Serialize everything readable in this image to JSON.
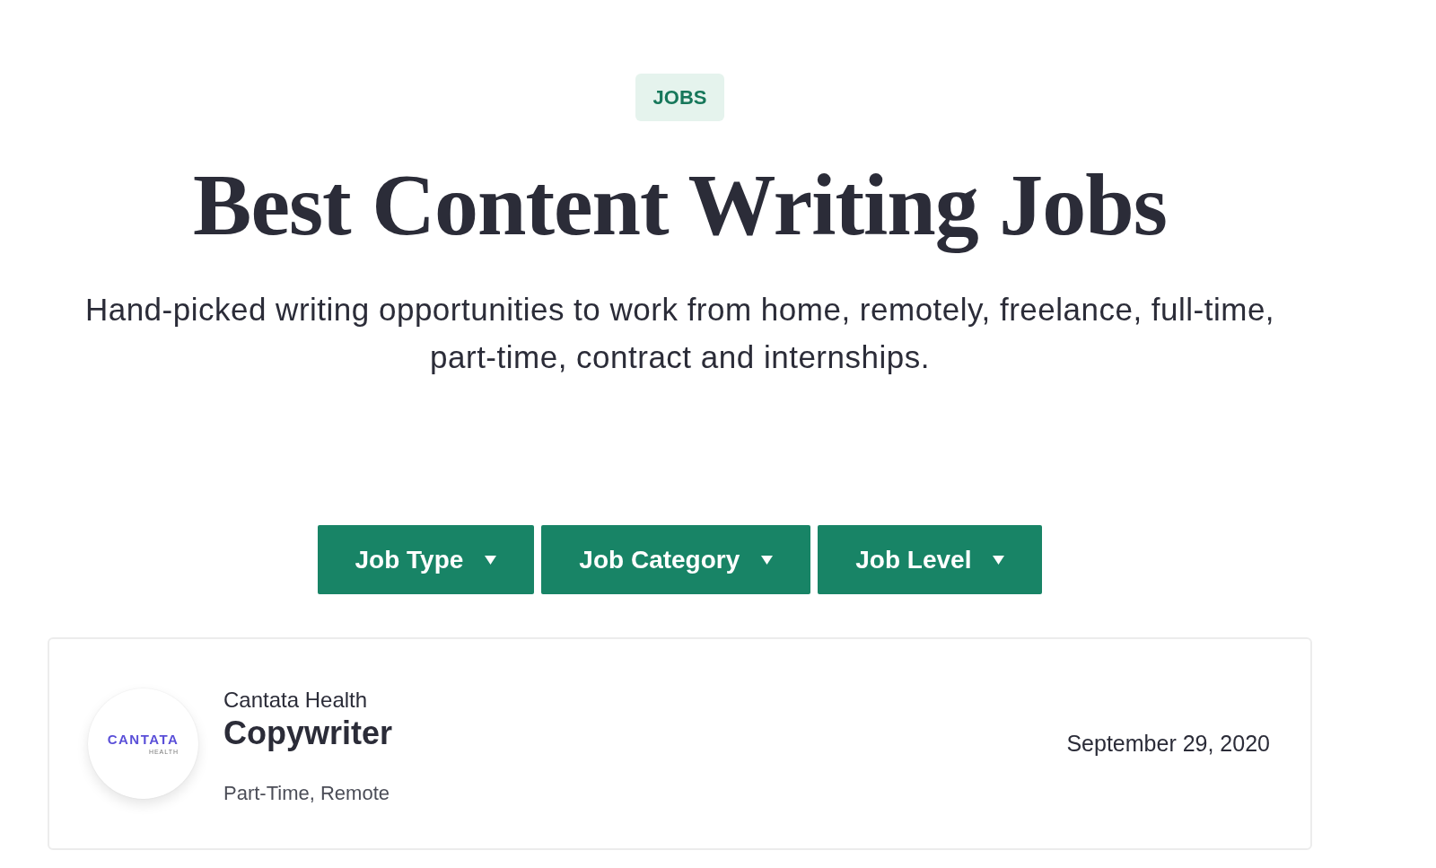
{
  "badge": "JOBS",
  "title": "Best Content Writing Jobs",
  "subtitle": "Hand-picked writing opportunities to work from home, remotely, freelance, full-time, part-time, contract and internships.",
  "filters": [
    {
      "label": "Job Type"
    },
    {
      "label": "Job Category"
    },
    {
      "label": "Job Level"
    }
  ],
  "jobs": [
    {
      "company": "Cantata Health",
      "logo": {
        "name": "CANTATA",
        "subtext": "HEALTH"
      },
      "title": "Copywriter",
      "tags": "Part-Time, Remote",
      "date": "September 29, 2020"
    }
  ]
}
